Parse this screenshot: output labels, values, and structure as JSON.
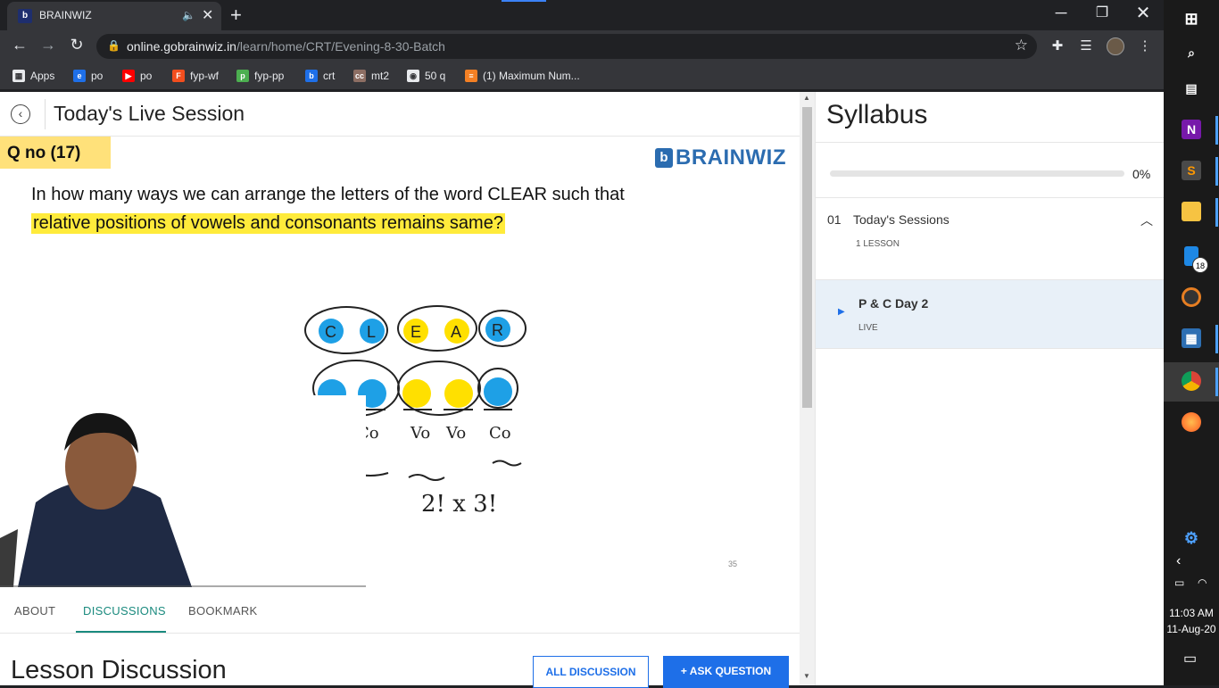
{
  "browser": {
    "tab_title": "BRAINWIZ",
    "tab_favicon": "b",
    "tab_audio_icon": "speaker-icon",
    "new_tab_symbol": "+",
    "url_domain": "online.gobrainwiz.in",
    "url_path": "/learn/home/CRT/Evening-8-30-Batch",
    "win_min": "─",
    "win_max": "❐",
    "win_close": "✕"
  },
  "bookmarks": [
    {
      "label": "Apps",
      "icon": "apps-grid-icon",
      "color": "#e8eaed",
      "glyph": "▦"
    },
    {
      "label": "po",
      "icon": "edge-icon",
      "color": "#1e6fe8",
      "glyph": "e"
    },
    {
      "label": "po",
      "icon": "youtube-icon",
      "color": "#ff0000",
      "glyph": "▶"
    },
    {
      "label": "fyp-wf",
      "icon": "figma-icon",
      "color": "#f24e1e",
      "glyph": "F"
    },
    {
      "label": "fyp-pp",
      "icon": "pp-icon",
      "color": "#4caf50",
      "glyph": "p"
    },
    {
      "label": "crt",
      "icon": "brainwiz-icon",
      "color": "#1e6fe8",
      "glyph": "b"
    },
    {
      "label": "mt2",
      "icon": "cc-icon",
      "color": "#8d6e63",
      "glyph": "cc"
    },
    {
      "label": "50 q",
      "icon": "globe-icon",
      "color": "#e8eaed",
      "glyph": "◉"
    },
    {
      "label": "(1) Maximum Num...",
      "icon": "stack-icon",
      "color": "#f48024",
      "glyph": "≡"
    }
  ],
  "session": {
    "title": "Today's Live Session",
    "back_symbol": "‹"
  },
  "video": {
    "qno": "Q no (17)",
    "brand": "BRAINWIZ",
    "brand_mark": "b",
    "question_line1": "In how many ways we can arrange the letters of the word CLEAR such that",
    "question_line2": "relative positions of vowels and consonants remains same?",
    "letters": [
      "C",
      "L",
      "E",
      "A",
      "R"
    ],
    "slot_labels": [
      "Co",
      "Co",
      "Vo",
      "Vo",
      "Co"
    ],
    "answer": "2! x 3!",
    "page_num": "35"
  },
  "tabs": {
    "about": "ABOUT",
    "discussions": "DISCUSSIONS",
    "bookmark": "BOOKMARK"
  },
  "discussion": {
    "heading": "Lesson Discussion",
    "all_button": "ALL DISCUSSION",
    "ask_button": "+ ASK QUESTION"
  },
  "syllabus": {
    "title": "Syllabus",
    "progress_value": 0,
    "progress_text": "0%",
    "section_num": "01",
    "section_title": "Today's Sessions",
    "section_count": "1 LESSON",
    "lesson_title": "P & C Day 2",
    "lesson_status": "LIVE"
  },
  "taskbar": {
    "time": "11:03 AM",
    "date": "11-Aug-20",
    "badge": "18"
  }
}
